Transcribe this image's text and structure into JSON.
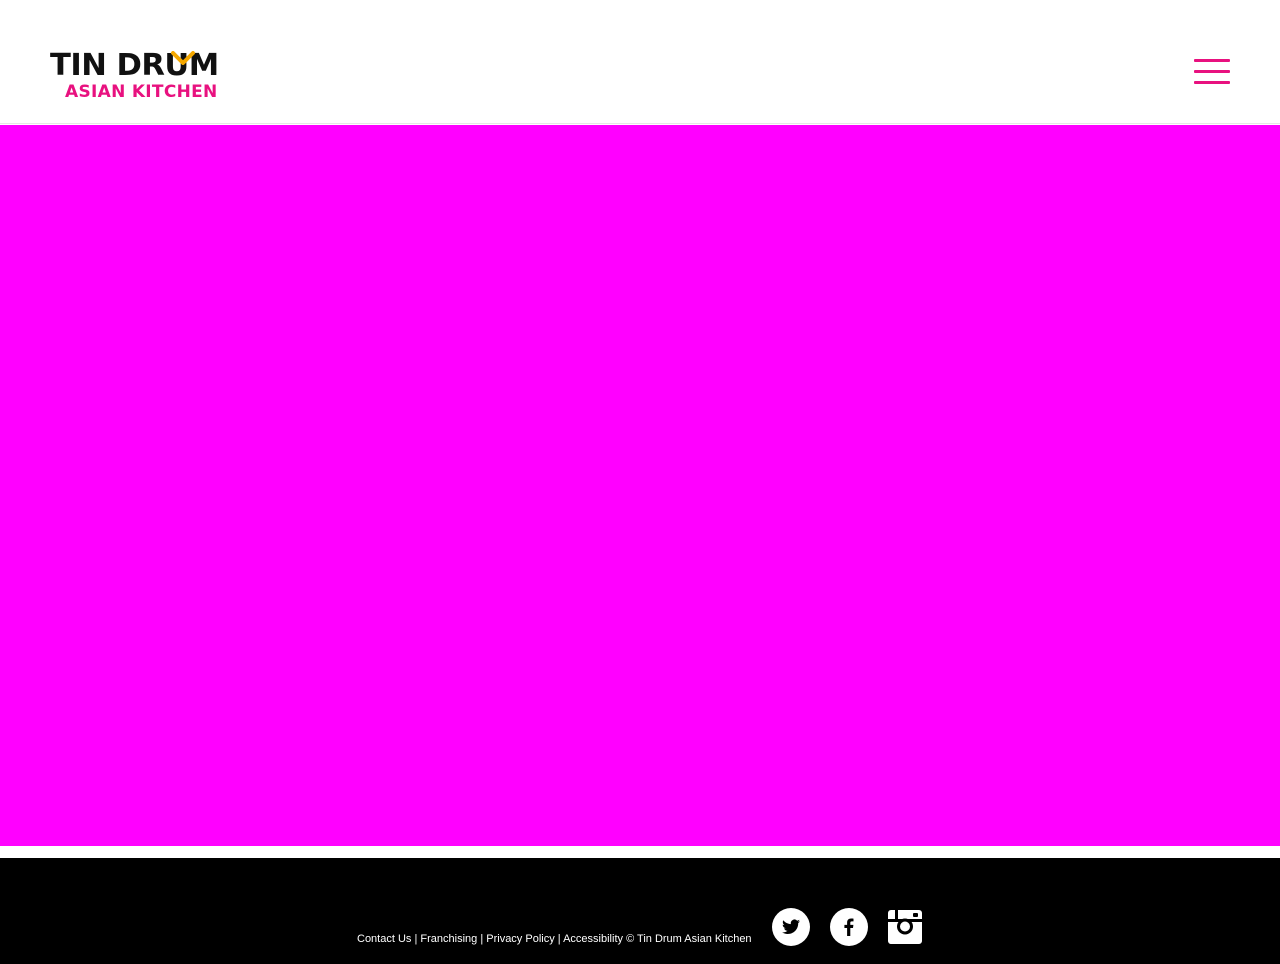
{
  "brand": {
    "name_top": "TIN DRUM",
    "name_bottom": "ASIAN KITCHEN",
    "primary_color": "#e8117f",
    "accent_color": "#f5a800",
    "dark_color": "#111111"
  },
  "header": {
    "menu_icon": "hamburger-icon"
  },
  "hero": {
    "background_color": "#ff00ff"
  },
  "footer": {
    "links": {
      "contact": "Contact Us",
      "franchising": "Franchising",
      "privacy": "Privacy Policy",
      "accessibility": "Accessibility"
    },
    "separator": "|",
    "copyright": "© Tin Drum Asian Kitchen",
    "social": [
      {
        "icon": "twitter-icon"
      },
      {
        "icon": "facebook-icon"
      },
      {
        "icon": "instagram-icon"
      }
    ]
  }
}
